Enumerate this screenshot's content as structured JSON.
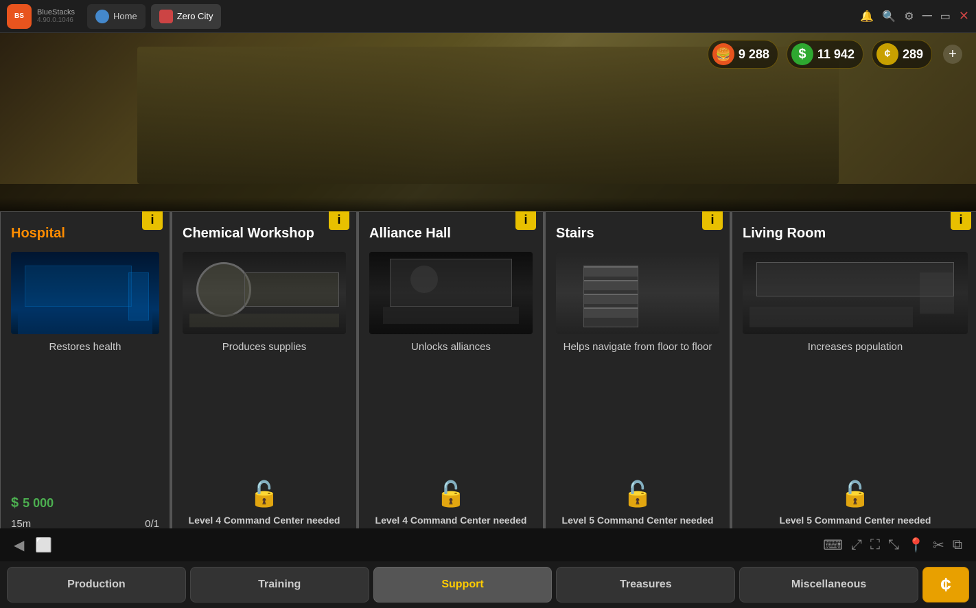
{
  "titlebar": {
    "app_name": "BlueStacks",
    "app_version": "4.90.0.1046",
    "tabs": [
      {
        "id": "home",
        "label": "Home",
        "active": false
      },
      {
        "id": "zero-city",
        "label": "Zero City",
        "active": true
      }
    ],
    "controls": [
      "notification",
      "search",
      "gear",
      "minimize",
      "maximize",
      "close"
    ]
  },
  "resources": {
    "food": {
      "icon": "🍔",
      "value": "9 288"
    },
    "cash": {
      "icon": "$",
      "value": "11 942"
    },
    "coin": {
      "icon": "¢",
      "value": "289"
    }
  },
  "cards": [
    {
      "id": "hospital",
      "title": "Hospital",
      "title_color": "orange",
      "description": "Restores health",
      "cost": "5 000",
      "time": "15m",
      "slots": "0/1",
      "locked": false,
      "lock_text": null,
      "image": "hospital"
    },
    {
      "id": "chemical-workshop",
      "title": "Chemical Workshop",
      "title_color": "white",
      "description": "Produces supplies",
      "cost": null,
      "time": null,
      "slots": null,
      "locked": true,
      "lock_text": "Level 4 Command Center needed",
      "image": "chemical"
    },
    {
      "id": "alliance-hall",
      "title": "Alliance Hall",
      "title_color": "white",
      "description": "Unlocks alliances",
      "cost": null,
      "time": null,
      "slots": null,
      "locked": true,
      "lock_text": "Level 4 Command Center needed",
      "image": "alliance"
    },
    {
      "id": "stairs",
      "title": "Stairs",
      "title_color": "white",
      "description": "Helps navigate from floor to floor",
      "cost": null,
      "time": null,
      "slots": null,
      "locked": true,
      "lock_text": "Level 5 Command Center needed",
      "image": "stairs"
    },
    {
      "id": "living-room",
      "title": "Living Room",
      "title_color": "white",
      "description": "Increases population",
      "cost": null,
      "time": null,
      "slots": null,
      "locked": true,
      "lock_text": "Level 5 Command Center needed",
      "image": "living"
    }
  ],
  "bottom_tabs": [
    {
      "id": "production",
      "label": "Production",
      "active": false
    },
    {
      "id": "training",
      "label": "Training",
      "active": false
    },
    {
      "id": "support",
      "label": "Support",
      "active": true
    },
    {
      "id": "treasures",
      "label": "Treasures",
      "active": false
    },
    {
      "id": "miscellaneous",
      "label": "Miscellaneous",
      "active": false
    },
    {
      "id": "coin",
      "label": "¢",
      "active": false,
      "special": true
    }
  ],
  "info_button_label": "i",
  "lock_icon": "🔓",
  "dollar_sign": "$"
}
